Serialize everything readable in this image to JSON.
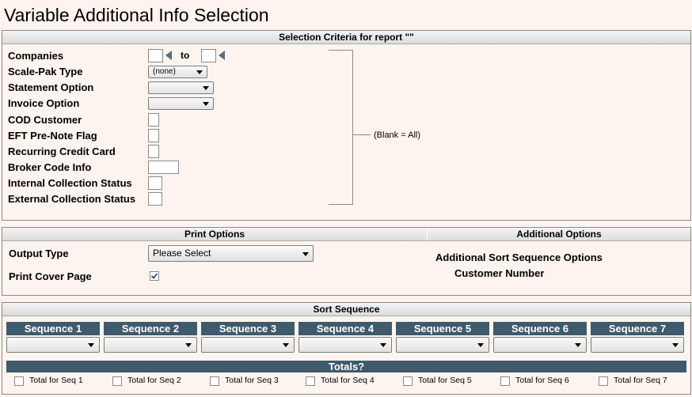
{
  "title": "Variable Additional Info Selection",
  "criteria": {
    "header": "Selection Criteria for report \"\"",
    "companies_label": "Companies",
    "to_label": "to",
    "scale_pak_label": "Scale-Pak Type",
    "scale_pak_value": "(none)",
    "statement_label": "Statement Option",
    "statement_value": "",
    "invoice_label": "Invoice Option",
    "invoice_value": "",
    "cod_label": "COD Customer",
    "eft_label": "EFT Pre-Note Flag",
    "recurring_label": "Recurring Credit Card",
    "broker_label": "Broker Code Info",
    "internal_label": "Internal Collection Status",
    "external_label": "External Collection Status",
    "blank_note": "(Blank = All)"
  },
  "print_options": {
    "header": "Print Options",
    "output_type_label": "Output Type",
    "output_type_value": "Please Select",
    "cover_page_label": "Print Cover Page",
    "cover_page_checked": true
  },
  "additional_options": {
    "header": "Additional Options",
    "sort_title": "Additional Sort Sequence Options",
    "sort_value": "Customer Number"
  },
  "sort_sequence": {
    "header": "Sort Sequence",
    "sequences": [
      "Sequence 1",
      "Sequence 2",
      "Sequence 3",
      "Sequence 4",
      "Sequence 5",
      "Sequence 6",
      "Sequence 7"
    ],
    "totals_header": "Totals?",
    "totals": [
      "Total for Seq 1",
      "Total for Seq 2",
      "Total for Seq 3",
      "Total for Seq 4",
      "Total for Seq 5",
      "Total for Seq 6",
      "Total for Seq 7"
    ]
  },
  "icons": {
    "checkmark": "checkmark-icon",
    "dropdown": "chevron-down-icon",
    "lookup": "left-triangle-icon"
  }
}
